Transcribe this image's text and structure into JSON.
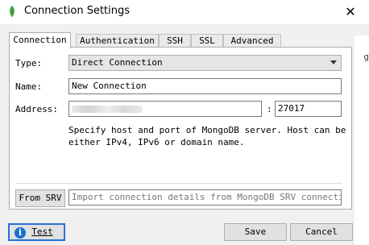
{
  "window": {
    "title": "Connection Settings",
    "close_glyph": "✕"
  },
  "background_fragment": "g",
  "tabs": [
    {
      "label": "Connection"
    },
    {
      "label": "Authentication"
    },
    {
      "label": "SSH"
    },
    {
      "label": "SSL"
    },
    {
      "label": "Advanced"
    }
  ],
  "connection": {
    "type_label": "Type:",
    "type_value": "Direct Connection",
    "name_label": "Name:",
    "name_value": "New Connection",
    "address_label": "Address:",
    "address_value": "",
    "port_separator": ":",
    "port_value": "27017",
    "hint_line1": "Specify host and port of MongoDB server. Host can be",
    "hint_line2": "either IPv4, IPv6 or domain name."
  },
  "srv": {
    "button_label": "From SRV",
    "input_placeholder": "Import connection details from MongoDB SRV connection…"
  },
  "footer": {
    "test_label": "Test",
    "save_label": "Save",
    "cancel_label": "Cancel"
  },
  "icons": {
    "app": "mongodb-leaf-icon",
    "test": "info-icon",
    "type_dropdown": "chevron-down-icon"
  },
  "colors": {
    "accent": "#1b6fd1",
    "app_icon": "#4aa84a"
  }
}
